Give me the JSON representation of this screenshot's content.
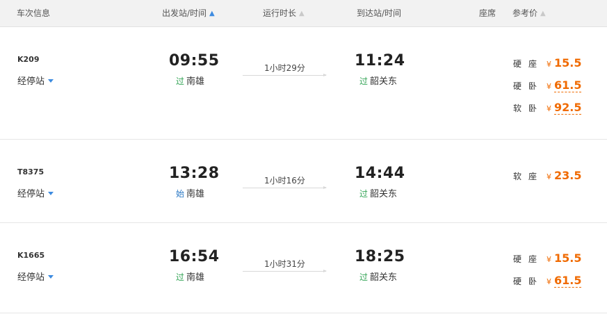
{
  "header": {
    "train_info": "车次信息",
    "depart": "出发站/时间",
    "duration": "运行时长",
    "arrive": "到达站/时间",
    "seat": "座席",
    "price": "参考价"
  },
  "trains": [
    {
      "number": "K209",
      "stops_label": "经停站",
      "dep_time": "09:55",
      "dep_tag": "过",
      "dep_station": "南雄",
      "duration": "1小时29分",
      "arr_time": "11:24",
      "arr_tag": "过",
      "arr_station": "韶关东",
      "prices": [
        {
          "seat": "硬座",
          "currency": "¥",
          "amount": "15.5"
        },
        {
          "seat": "硬卧",
          "currency": "¥",
          "amount": "61.5"
        },
        {
          "seat": "软卧",
          "currency": "¥",
          "amount": "92.5"
        }
      ]
    },
    {
      "number": "T8375",
      "stops_label": "经停站",
      "dep_time": "13:28",
      "dep_tag": "始",
      "dep_station": "南雄",
      "duration": "1小时16分",
      "arr_time": "14:44",
      "arr_tag": "过",
      "arr_station": "韶关东",
      "prices": [
        {
          "seat": "软座",
          "currency": "¥",
          "amount": "23.5"
        }
      ]
    },
    {
      "number": "K1665",
      "stops_label": "经停站",
      "dep_time": "16:54",
      "dep_tag": "过",
      "dep_station": "南雄",
      "duration": "1小时31分",
      "arr_time": "18:25",
      "arr_tag": "过",
      "arr_station": "韶关东",
      "prices": [
        {
          "seat": "硬座",
          "currency": "¥",
          "amount": "15.5"
        },
        {
          "seat": "硬卧",
          "currency": "¥",
          "amount": "61.5"
        }
      ]
    }
  ]
}
